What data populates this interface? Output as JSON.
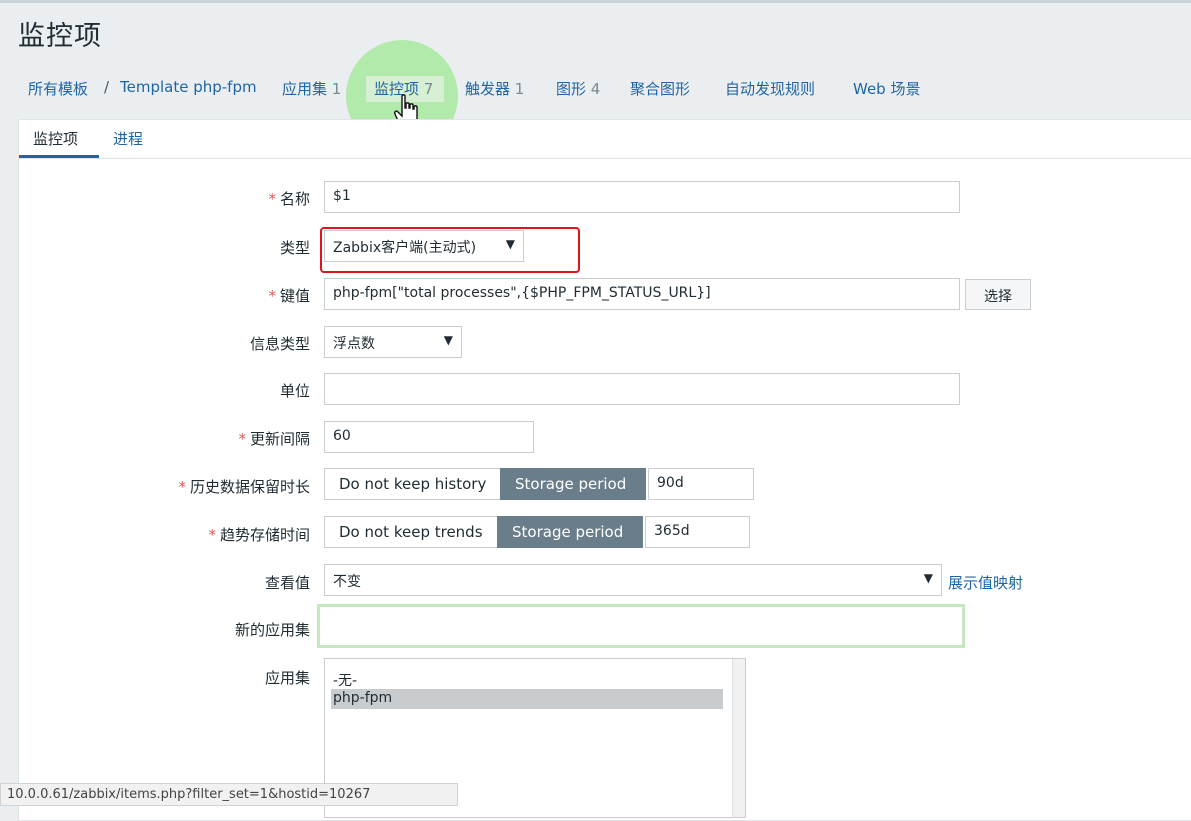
{
  "page": {
    "title": "监控项"
  },
  "breadcrumb": {
    "all_templates": "所有模板",
    "separator": "/",
    "template": "Template php-fpm",
    "tabs": [
      {
        "label": "应用集",
        "count": "1"
      },
      {
        "label": "监控项",
        "count": "7"
      },
      {
        "label": "触发器",
        "count": "1"
      },
      {
        "label": "图形",
        "count": "4"
      },
      {
        "label": "聚合图形",
        "count": ""
      },
      {
        "label": "自动发现规则",
        "count": ""
      },
      {
        "label": "Web 场景",
        "count": ""
      }
    ]
  },
  "subtabs": {
    "item": "监控项",
    "process": "进程"
  },
  "form": {
    "name": {
      "label": "名称",
      "value": "$1"
    },
    "type": {
      "label": "类型",
      "value": "Zabbix客户端(主动式)"
    },
    "key": {
      "label": "键值",
      "value": "php-fpm[\"total processes\",{$PHP_FPM_STATUS_URL}]",
      "select_button": "选择"
    },
    "info_type": {
      "label": "信息类型",
      "value": "浮点数"
    },
    "units": {
      "label": "单位",
      "value": ""
    },
    "interval": {
      "label": "更新间隔",
      "value": "60"
    },
    "history": {
      "label": "历史数据保留时长",
      "opt_off": "Do not keep history",
      "opt_on": "Storage period",
      "value": "90d"
    },
    "trends": {
      "label": "趋势存储时间",
      "opt_off": "Do not keep trends",
      "opt_on": "Storage period",
      "value": "365d"
    },
    "show_value": {
      "label": "查看值",
      "value": "不变",
      "link": "展示值映射"
    },
    "new_app": {
      "label": "新的应用集",
      "value": ""
    },
    "applications": {
      "label": "应用集",
      "items": [
        "-无-",
        "php-fpm"
      ],
      "selected": "php-fpm"
    }
  },
  "statusbar": {
    "url": "10.0.0.61/zabbix/items.php?filter_set=1&hostid=10267"
  },
  "colors": {
    "link": "#1f65a6",
    "required": "#e45959",
    "highlight_box": "#e0151c",
    "segment_active": "#6a7d8b"
  }
}
